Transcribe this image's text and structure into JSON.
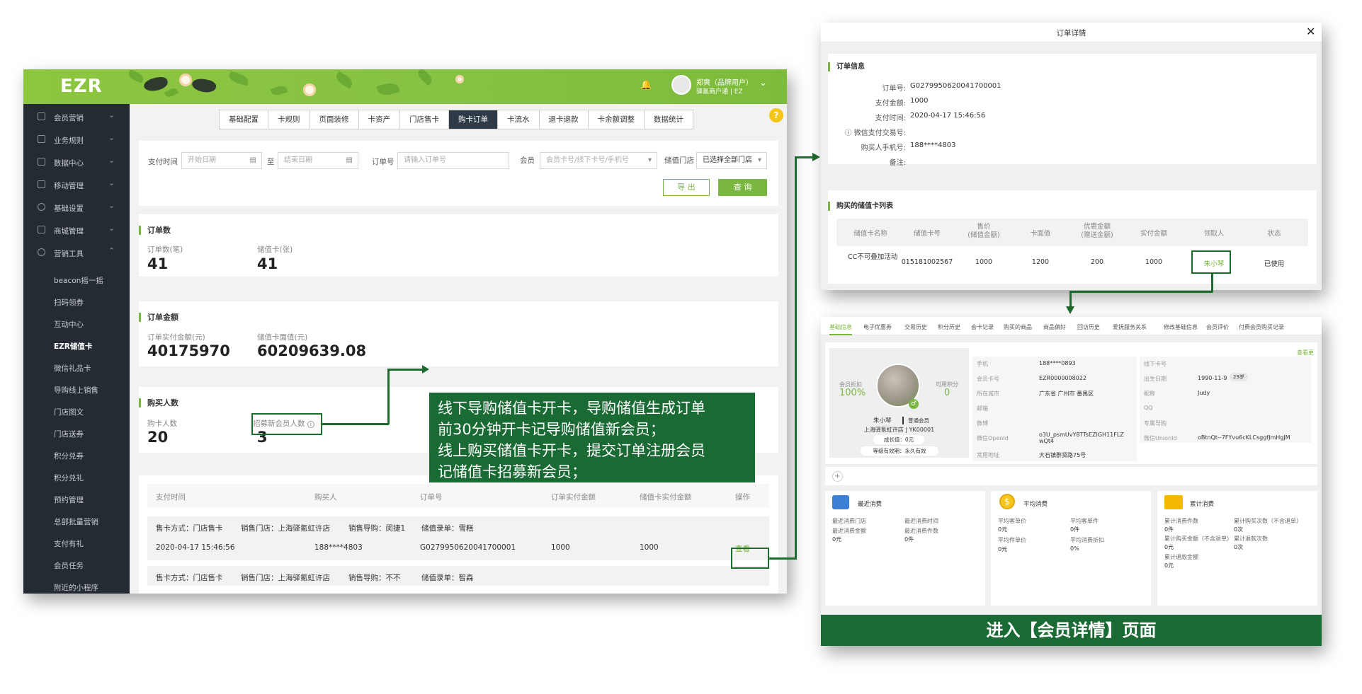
{
  "app": {
    "logo": "EZR",
    "user_name": "郑爽（品牌用户）",
    "user_org": "驿氪商户通 | EZ"
  },
  "sidebar": {
    "groups": [
      {
        "label": "会员营销",
        "icon": "member-icon"
      },
      {
        "label": "业务规则",
        "icon": "grid-icon"
      },
      {
        "label": "数据中心",
        "icon": "chart-icon"
      },
      {
        "label": "移动管理",
        "icon": "mobile-icon"
      },
      {
        "label": "基础设置",
        "icon": "settings-icon"
      },
      {
        "label": "商城管理",
        "icon": "shop-icon"
      },
      {
        "label": "营销工具",
        "icon": "tool-icon"
      }
    ],
    "sub_items": [
      "beacon摇一摇",
      "扫码领券",
      "互动中心",
      "EZR储值卡",
      "微信礼品卡",
      "导购线上销售",
      "门店图文",
      "门店送券",
      "积分兑券",
      "积分兑礼",
      "预约管理",
      "总部批量营销",
      "支付有礼",
      "会员任务",
      "附近的小程序"
    ]
  },
  "tabs": [
    "基础配置",
    "卡规则",
    "页面装修",
    "卡资产",
    "门店售卡",
    "购卡订单",
    "卡流水",
    "退卡退款",
    "卡余额调整",
    "数据统计"
  ],
  "active_tab": "购卡订单",
  "filters": {
    "pay_time_label": "支付时间",
    "start_placeholder": "开始日期",
    "to_label": "至",
    "end_placeholder": "结束日期",
    "order_no_label": "订单号",
    "order_no_placeholder": "请输入订单号",
    "member_label": "会员",
    "member_placeholder": "会员卡号/线下卡号/手机号",
    "store_label": "储值门店",
    "store_value": "已选择全部门店",
    "export_button": "导 出",
    "query_button": "查 询"
  },
  "order_count": {
    "title": "订单数",
    "orders_label": "订单数(笔)",
    "orders_value": "41",
    "cards_label": "储值卡(张)",
    "cards_value": "41"
  },
  "order_amount": {
    "title": "订单金额",
    "paid_label": "订单实付金额(元)",
    "paid_value": "40175970",
    "face_label": "储值卡面值(元)",
    "face_value": "60209639.08"
  },
  "buyers": {
    "title": "购买人数",
    "buyers_label": "购卡人数",
    "buyers_value": "20",
    "new_label": "招募新会员人数",
    "new_value": "3"
  },
  "orders_table": {
    "headers": [
      "支付时间",
      "购买人",
      "订单号",
      "订单实付金额",
      "储值卡实付金额",
      "操作"
    ],
    "row1_meta": {
      "sale_type": "售卡方式：门店售卡",
      "store": "销售门店：上海驿氪虹许店",
      "guide": "销售导购：闵捷1",
      "recorder": "储值录单：雪糕"
    },
    "row1": {
      "time": "2020-04-17 15:46:56",
      "buyer": "188****4803",
      "order_no": "G0279950620041700001",
      "paid": "1000",
      "card_paid": "1000",
      "action": "查看"
    },
    "row2_meta": {
      "sale_type": "售卡方式：门店售卡",
      "store": "销售门店：上海驿氪虹许店",
      "guide": "销售导购：不不",
      "recorder": "储值录单：智森"
    }
  },
  "callout": {
    "lines": [
      "线下导购储值卡开卡，导购储值生成订单",
      "前30分钟开卡记导购储值新会员；",
      "线上购买储值卡开卡，提交订单注册会员",
      "记储值卡招募新会员；"
    ]
  },
  "order_detail": {
    "window_title": "订单详情",
    "info_title": "订单信息",
    "fields": [
      {
        "k": "订单号:",
        "v": "G0279950620041700001"
      },
      {
        "k": "支付金额:",
        "v": "1000"
      },
      {
        "k": "支付时间:",
        "v": "2020-04-17 15:46:56"
      },
      {
        "k": "微信支付交易号:",
        "v": ""
      },
      {
        "k": "购买人手机号:",
        "v": "188****4803"
      },
      {
        "k": "备注:",
        "v": ""
      }
    ],
    "cards_title": "购买的储值卡列表",
    "card_headers": [
      "储值卡名称",
      "储值卡号",
      "售价\n(储值金额)",
      "卡面值",
      "优惠金额\n(赠送金额)",
      "实付金额",
      "领取人",
      "状态"
    ],
    "card_row": [
      "CC不可叠加活动",
      "015181002567",
      "1000",
      "1200",
      "200",
      "1000",
      "朱小琴",
      "已使用"
    ]
  },
  "member_detail": {
    "tabs": [
      "基础信息",
      "电子优惠券",
      "交易历史",
      "积分历史",
      "会卡记录",
      "购买的商品",
      "商品偏好",
      "回访历史",
      "爱抚服务关系",
      "修改基础信息",
      "会员评价",
      "付费会员购买记录"
    ],
    "see_more": "查看更多",
    "discount_label": "会员折扣",
    "discount_value": "100%",
    "points_label": "可用积分",
    "points_value": "0",
    "name": "朱小琴",
    "level": "普通会员",
    "store": "上海驿氪虹许店 | YK00001",
    "growth": "成长值：0元",
    "validity": "等级有效期：永久有效",
    "fields_left": [
      {
        "k": "手机",
        "v": "188****0893"
      },
      {
        "k": "会员卡号",
        "v": "EZR0000008022"
      },
      {
        "k": "所在城市",
        "v": "广东省 广州市 番禺区"
      },
      {
        "k": "邮箱",
        "v": ""
      },
      {
        "k": "微博",
        "v": ""
      },
      {
        "k": "微信OpenId",
        "v": "o3U_psmUvY8TTsEZIGH11FLZwQt4"
      },
      {
        "k": "常用地址",
        "v": "大石镇群贤路75号"
      }
    ],
    "fields_right": [
      {
        "k": "线下卡号",
        "v": ""
      },
      {
        "k": "出生日期",
        "v": "1990-11-9"
      },
      {
        "k": "昵称",
        "v": "Judy"
      },
      {
        "k": "QQ",
        "v": ""
      },
      {
        "k": "专属导购",
        "v": ""
      },
      {
        "k": "微信UnionId",
        "v": "oBtnQt--7FYvu6cKLCsggfJmHgJM"
      }
    ],
    "age_badge": "29岁",
    "cards": [
      {
        "title": "最近消费",
        "items": [
          [
            "最近消费门店",
            ""
          ],
          [
            "最近消费时间",
            ""
          ],
          [
            "最近消费金额",
            "0元"
          ],
          [
            "最近消费件数",
            "0件"
          ]
        ]
      },
      {
        "title": "平均消费",
        "items": [
          [
            "平均客单价",
            "0元"
          ],
          [
            "平均客单件",
            "0件"
          ],
          [
            "平均件单价",
            "0元"
          ],
          [
            "平均消费折扣",
            "0%"
          ]
        ]
      },
      {
        "title": "累计消费",
        "items": [
          [
            "累计消费件数",
            "0件"
          ],
          [
            "累计购买次数（不含退单）",
            "0次"
          ],
          [
            "累计购买金额（不含退单）",
            "0元"
          ],
          [
            "累计退款次数",
            "0次"
          ],
          [
            "累计退款金额",
            "0元"
          ]
        ]
      }
    ],
    "banner": "进入【会员详情】页面"
  },
  "colors": {
    "brand_green": "#7ab740",
    "dark_green": "#1a6a34",
    "sidebar_bg": "#242b33"
  }
}
